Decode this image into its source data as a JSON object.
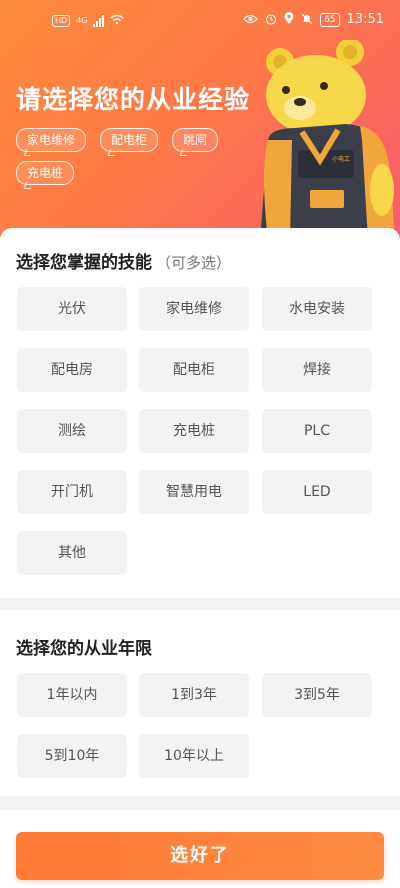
{
  "status_bar": {
    "hd_label": "HD",
    "network_label": "4G",
    "battery": "65",
    "time": "13:51"
  },
  "hero": {
    "title": "请选择您的从业经验",
    "tags": [
      "家电维修",
      "配电柜",
      "跳闸",
      "充电桩"
    ],
    "mascot_badge": "小电工"
  },
  "skills": {
    "title": "选择您掌握的技能",
    "subtitle": "（可多选）",
    "options": [
      "光伏",
      "家电维修",
      "水电安装",
      "配电房",
      "配电柜",
      "焊接",
      "测绘",
      "充电桩",
      "PLC",
      "开门机",
      "智慧用电",
      "LED",
      "其他"
    ]
  },
  "years": {
    "title": "选择您的从业年限",
    "options": [
      "1年以内",
      "1到3年",
      "3到5年",
      "5到10年",
      "10年以上"
    ]
  },
  "footer": {
    "submit_label": "选好了"
  },
  "colors": {
    "hero_gradient_start": "#ff8a3d",
    "hero_gradient_end": "#f65b6e",
    "accent": "#ff7a33",
    "option_bg": "#f3f3f5"
  }
}
